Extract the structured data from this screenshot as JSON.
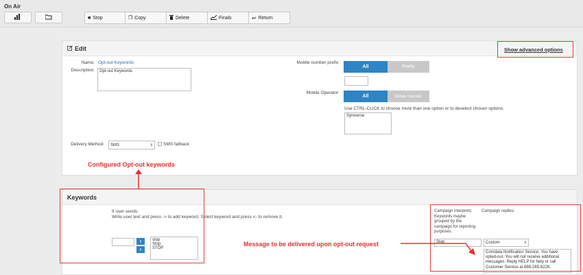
{
  "topbar": {
    "title": "On Air",
    "left_icons": [
      "bar-chart-icon",
      "folder-open-icon"
    ],
    "tools": [
      {
        "label": "Stop",
        "icon": "stop-icon",
        "glyph": "■"
      },
      {
        "label": "Copy",
        "icon": "copy-icon",
        "glyph": "❐"
      },
      {
        "label": "Delete",
        "icon": "trash-icon",
        "glyph": "🗑"
      },
      {
        "label": "Finals",
        "icon": "line-chart-icon",
        "glyph": "📈"
      },
      {
        "label": "Return",
        "icon": "return-arrow-icon",
        "glyph": "↩"
      }
    ]
  },
  "edit": {
    "title": "Edit",
    "advanced_link": "Show advanced options",
    "name_label": "Name:",
    "name_value": "Opt-out Keywords",
    "description_label": "Description:",
    "description_value": "Opt-out Keywords",
    "prefix_label": "Mobile number prefix:",
    "prefix_all": "All",
    "prefix_option": "Prefix",
    "operator_label": "Mobile Operator:",
    "operator_all": "All",
    "operator_option": "Mobile Operator",
    "operator_hint": "Use CTRL-CLICK to choose more than one option or to deselect chosen options.",
    "operator_list": [
      "Syniverse"
    ],
    "delivery_label": "Delivery Method:",
    "delivery_value": "SMS",
    "sms_fallback": "SMS fallback"
  },
  "annotations": {
    "configured": "Configured Opt-out keywords",
    "message": "Message to be delivered upon opt-out request"
  },
  "keywords": {
    "title": "Keywords",
    "if_user_sends": "If user sends:",
    "instructions": "Write user text and press -> to add keyword. Select keyword and press <- to remove it.",
    "list": [
      "stop",
      "Stop",
      "STOP"
    ],
    "interprets_header": "Campaign interprets:",
    "interprets_note": "Keywords maybe grouped by the campaign for reporting purposes.",
    "replies_header": "Campaign replies:",
    "interprets_value": "Stop",
    "replies_select": "Custom",
    "reply_text": "Comdata Notification Service. You have opted-out. You will not receive additional messages. Reply HELP for help or call Customer Service at 888-265-8228."
  }
}
